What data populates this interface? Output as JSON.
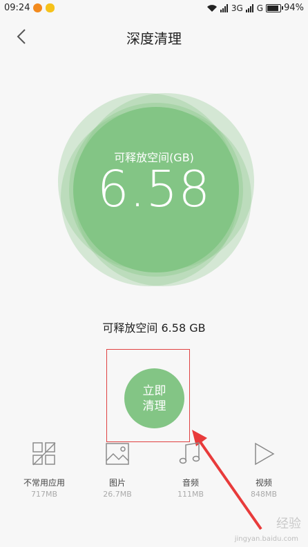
{
  "status_bar": {
    "time": "09:24",
    "network": "3G",
    "network2": "G",
    "battery": "94%",
    "battery_level": 0.94
  },
  "header": {
    "title": "深度清理"
  },
  "circle": {
    "label": "可释放空间(GB)",
    "value": "6.58"
  },
  "summary": "可释放空间 6.58 GB",
  "clean_button": {
    "label": "立即清理"
  },
  "categories": [
    {
      "name": "不常用应用",
      "size": "717MB",
      "icon": "apps-icon"
    },
    {
      "name": "图片",
      "size": "26.7MB",
      "icon": "image-icon"
    },
    {
      "name": "音频",
      "size": "111MB",
      "icon": "music-icon"
    },
    {
      "name": "视频",
      "size": "848MB",
      "icon": "play-icon"
    }
  ],
  "colors": {
    "accent_green": "#83c585",
    "highlight_red": "#e04040"
  },
  "watermark": {
    "text": "经验",
    "url": "jingyan.baidu.com"
  }
}
